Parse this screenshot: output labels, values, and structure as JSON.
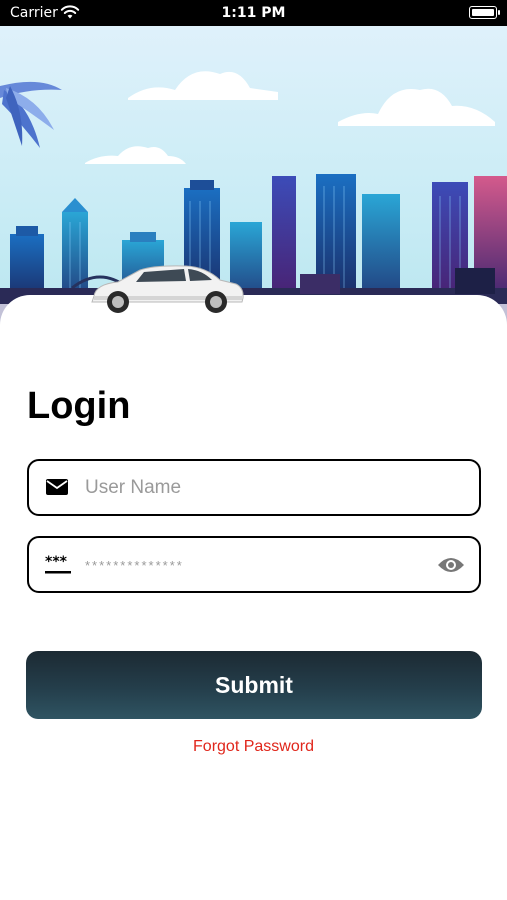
{
  "status_bar": {
    "carrier": "Carrier",
    "time": "1:11 PM",
    "battery_level": 1.0
  },
  "login": {
    "title": "Login",
    "username_placeholder": "User Name",
    "username_icon": "mail-icon",
    "password_placeholder": "**************",
    "password_icon": "password-dots-icon",
    "visibility_icon": "eye-icon",
    "submit_label": "Submit",
    "forgot_label": "Forgot Password"
  },
  "colors": {
    "submit_gradient_top": "#1c2a33",
    "submit_gradient_bottom": "#2f5462",
    "link": "#e0261b"
  }
}
